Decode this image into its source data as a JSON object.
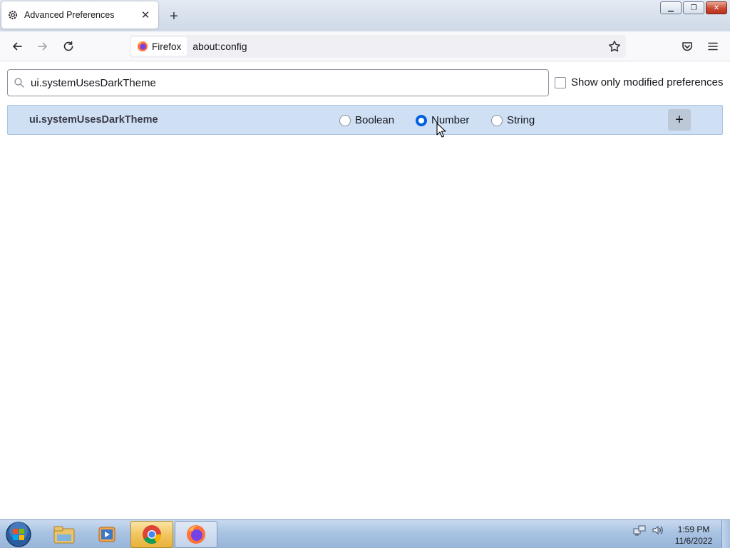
{
  "browser": {
    "tab": {
      "title": "Advanced Preferences",
      "close_glyph": "✕",
      "icon": "gear-icon"
    },
    "new_tab_glyph": "+",
    "window_buttons": {
      "minimize": "▁",
      "restore": "❐",
      "close": "✕"
    },
    "nav": {
      "back_icon": "back-arrow-icon",
      "forward_icon": "forward-arrow-icon",
      "reload_icon": "reload-icon"
    },
    "urlbar": {
      "identity_label": "Firefox",
      "url": "about:config"
    }
  },
  "config": {
    "search": {
      "value": "ui.systemUsesDarkTheme"
    },
    "modified_only": {
      "label": "Show only modified preferences",
      "checked": false
    },
    "new_pref": {
      "name": "ui.systemUsesDarkTheme",
      "types": [
        {
          "label": "Boolean",
          "checked": false
        },
        {
          "label": "Number",
          "checked": true
        },
        {
          "label": "String",
          "checked": false
        }
      ],
      "add_glyph": "+"
    }
  },
  "taskbar": {
    "apps": [
      "windows-explorer-icon",
      "media-player-icon",
      "chrome-icon",
      "firefox-icon"
    ],
    "clock": {
      "time": "1:59 PM",
      "date": "11/6/2022"
    }
  },
  "colors": {
    "accent": "#0060df",
    "row_highlight": "#cfe0f5"
  }
}
